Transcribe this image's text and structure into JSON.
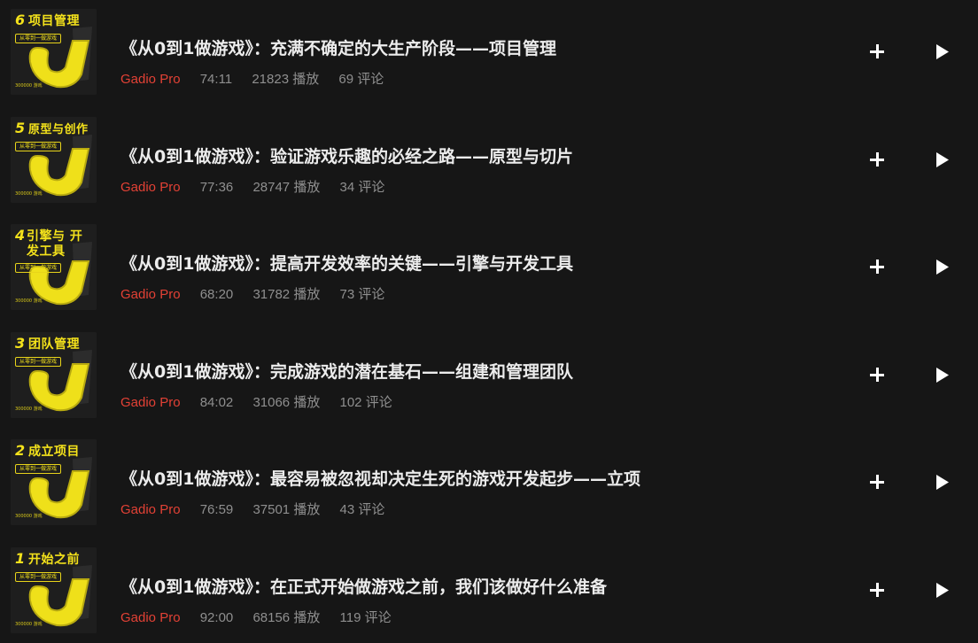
{
  "episodes": [
    {
      "title": "《从0到1做游戏》：充满不确定的大生产阶段——项目管理",
      "author": "Gadio Pro",
      "duration": "74:11",
      "plays": "21823 播放",
      "comments": "69 评论",
      "thumb": {
        "num": "6",
        "text": "项目管理",
        "sub": "从零到一做游戏",
        "foot": "300000 游戏"
      }
    },
    {
      "title": "《从0到1做游戏》：验证游戏乐趣的必经之路——原型与切片",
      "author": "Gadio Pro",
      "duration": "77:36",
      "plays": "28747 播放",
      "comments": "34 评论",
      "thumb": {
        "num": "5",
        "text": "原型与创作",
        "sub": "从零到一做游戏",
        "foot": "300000 游戏"
      }
    },
    {
      "title": "《从0到1做游戏》：提高开发效率的关键——引擎与开发工具",
      "author": "Gadio Pro",
      "duration": "68:20",
      "plays": "31782 播放",
      "comments": "73 评论",
      "thumb": {
        "num": "4",
        "text": "引擎与 开发工具",
        "sub": "从零到一做游戏",
        "foot": "300000 游戏"
      }
    },
    {
      "title": "《从0到1做游戏》：完成游戏的潜在基石——组建和管理团队",
      "author": "Gadio Pro",
      "duration": "84:02",
      "plays": "31066 播放",
      "comments": "102 评论",
      "thumb": {
        "num": "3",
        "text": "团队管理",
        "sub": "从零到一做游戏",
        "foot": "300000 游戏"
      }
    },
    {
      "title": "《从0到1做游戏》：最容易被忽视却决定生死的游戏开发起步——立项",
      "author": "Gadio Pro",
      "duration": "76:59",
      "plays": "37501 播放",
      "comments": "43 评论",
      "thumb": {
        "num": "2",
        "text": "成立项目",
        "sub": "从零到一做游戏",
        "foot": "300000 游戏"
      }
    },
    {
      "title": "《从0到1做游戏》：在正式开始做游戏之前，我们该做好什么准备",
      "author": "Gadio Pro",
      "duration": "92:00",
      "plays": "68156 播放",
      "comments": "119 评论",
      "thumb": {
        "num": "1",
        "text": "开始之前",
        "sub": "从零到一做游戏",
        "foot": "300000 游戏"
      }
    }
  ],
  "icons": {
    "add": "plus-icon",
    "play": "play-icon"
  },
  "colors": {
    "background": "#161616",
    "author": "#e24135",
    "accent_yellow": "#f4e21b",
    "title": "#ececec",
    "meta": "#8f8f8f"
  }
}
